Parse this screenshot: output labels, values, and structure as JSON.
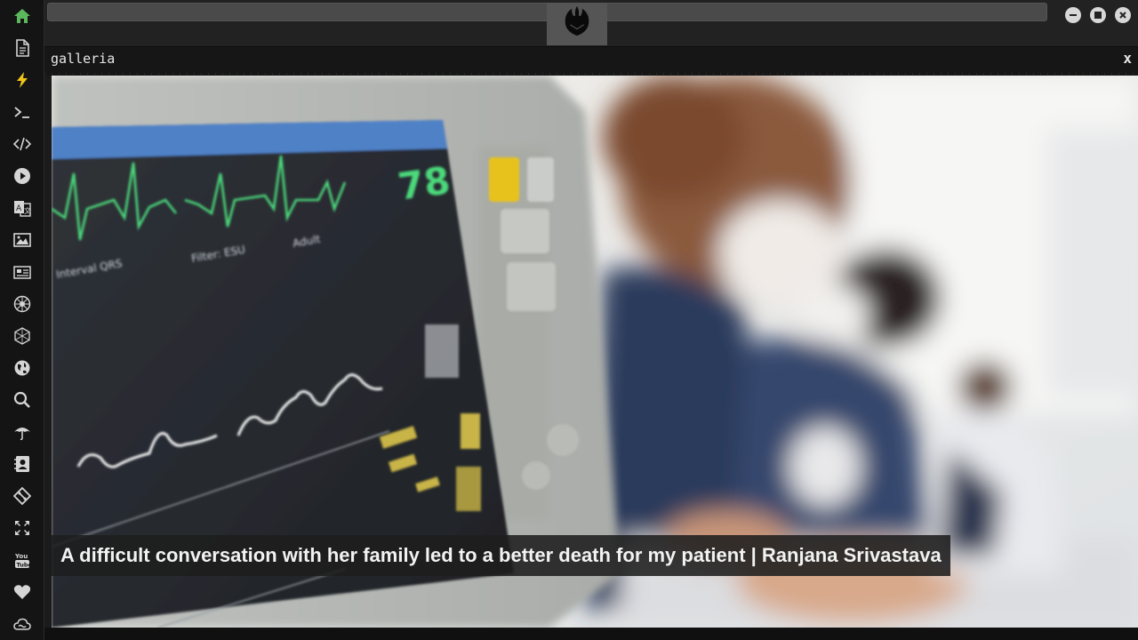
{
  "sidebar": {
    "items": [
      {
        "name": "home-icon",
        "color": "#5cb85c"
      },
      {
        "name": "document-icon"
      },
      {
        "name": "lightning-icon",
        "color": "#f0c419"
      },
      {
        "name": "terminal-icon"
      },
      {
        "name": "code-icon"
      },
      {
        "name": "play-icon"
      },
      {
        "name": "translate-icon"
      },
      {
        "name": "image-icon"
      },
      {
        "name": "newspaper-icon"
      },
      {
        "name": "rebel-alliance-icon"
      },
      {
        "name": "hexagon-icon"
      },
      {
        "name": "globe-icon"
      },
      {
        "name": "search-icon"
      },
      {
        "name": "umbrella-icon"
      },
      {
        "name": "contact-card-icon"
      },
      {
        "name": "git-icon"
      },
      {
        "name": "fullscreen-icon"
      },
      {
        "name": "youtube-icon"
      },
      {
        "name": "heart-icon"
      },
      {
        "name": "cloud-icon"
      }
    ]
  },
  "topbar": {
    "url_value": "",
    "window_controls": [
      "minimize-icon",
      "maximize-icon",
      "close-icon"
    ]
  },
  "panel": {
    "title": "galleria",
    "close_label": "x"
  },
  "gallery": {
    "caption": "A difficult conversation with her family led to a better death for my patient | Ranjana Srivastava",
    "monitor": {
      "top_labels": [
        "Adult",
        "Filter: ESU",
        "Interval QRS"
      ],
      "heart_rate": "78"
    }
  },
  "colors": {
    "accent_green": "#5cb85c",
    "accent_yellow": "#f0c419",
    "icon_gray": "#d5d5d5",
    "background": "#1b1b1b"
  }
}
